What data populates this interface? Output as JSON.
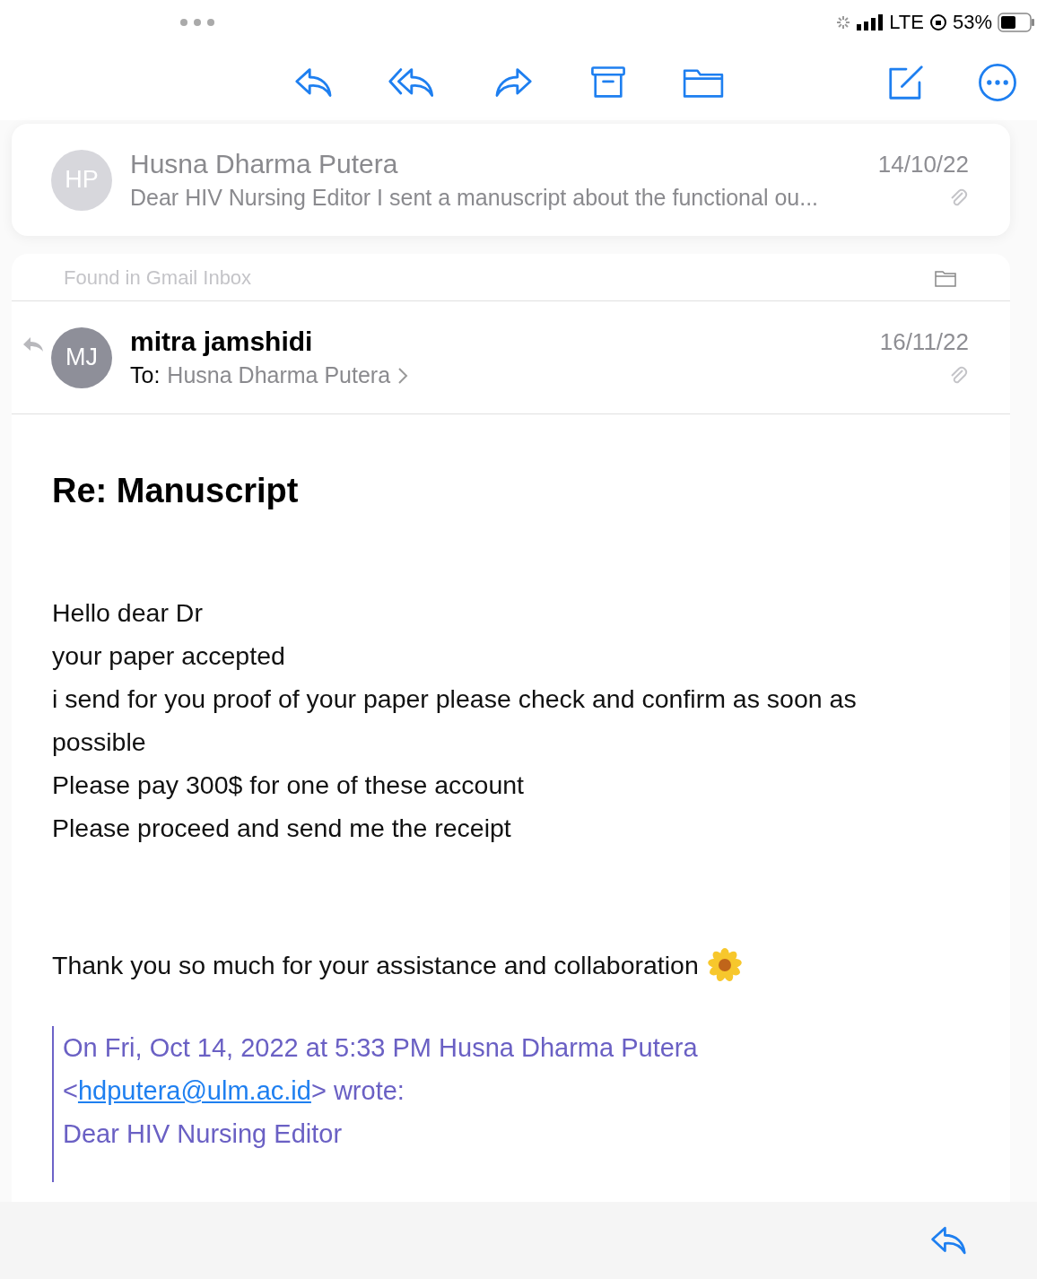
{
  "status_bar": {
    "network": "LTE",
    "battery": "53%"
  },
  "previous_message": {
    "initials": "HP",
    "sender": "Husna Dharma Putera",
    "date": "14/10/22",
    "preview": "Dear HIV Nursing Editor I sent a manuscript about the functional ou...",
    "has_attachment": true
  },
  "message": {
    "found_in": "Found in Gmail Inbox",
    "initials": "MJ",
    "sender": "mitra jamshidi",
    "to_label": "To:",
    "recipient": "Husna Dharma Putera",
    "date": "16/11/22",
    "has_attachment": true,
    "replied": true,
    "subject": "Re: Manuscript",
    "body": [
      "Hello dear Dr",
      "your paper accepted",
      "i send for you proof of your paper please check and confirm as soon as possible",
      "Please pay 300$ for one of these account",
      "Please proceed and send me the receipt"
    ],
    "closing": "Thank you so much for your assistance and collaboration",
    "quote": {
      "attribution": "On Fri, Oct 14, 2022 at 5:33 PM Husna Dharma Putera",
      "before_link": "<",
      "link": "hdputera@ulm.ac.id",
      "after_link": "> wrote:",
      "text": "Dear HIV Nursing Editor"
    }
  }
}
